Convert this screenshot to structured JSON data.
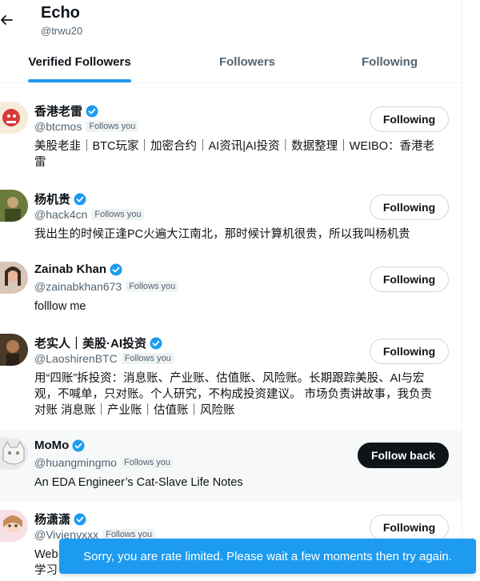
{
  "header": {
    "title": "Echo",
    "handle": "@trwu20",
    "back_icon": "arrow-left-icon"
  },
  "tabs": [
    {
      "label": "Verified Followers",
      "active": true
    },
    {
      "label": "Followers",
      "active": false
    },
    {
      "label": "Following",
      "active": false
    }
  ],
  "users": [
    {
      "name": "香港老雷",
      "handle": "@btcmos",
      "follows_you": "Follows you",
      "verified": true,
      "bio_lines": [
        "美股老韭｜BTC玩家｜加密合约｜AI资讯|AI投资｜数据整理｜WEIBO：香港老",
        "雷"
      ],
      "button": "Following"
    },
    {
      "name": "杨机贵",
      "handle": "@hack4cn",
      "follows_you": "Follows you",
      "verified": true,
      "bio_lines": [
        "我出生的时候正逢PC火遍大江南北，那时候计算机很贵，所以我叫杨机贵"
      ],
      "button": "Following"
    },
    {
      "name": "Zainab Khan",
      "handle": "@zainabkhan673",
      "follows_you": "Follows you",
      "verified": true,
      "bio_lines": [
        "folllow me"
      ],
      "button": "Following"
    },
    {
      "name": "老实人｜美股·AI投资",
      "handle": "@LaoshirenBTC",
      "follows_you": "Follows you",
      "verified": true,
      "bio_lines": [
        "用“四账”拆投资：消息账、产业账、估值账、风险账。长期跟踪美股、AI与宏",
        "观，不喊单，只对账。个人研究，不构成投资建议。 市场负责讲故事，我负责",
        "对账 消息账｜产业账｜估值账｜风险账"
      ],
      "button": "Following"
    },
    {
      "name": "MoMo",
      "handle": "@huangmingmo",
      "follows_you": "Follows you",
      "verified": true,
      "bio_lines": [
        "An EDA Engineer’s Cat-Slave Life Notes"
      ],
      "button": "Follow back"
    },
    {
      "name": "杨潇潇",
      "handle": "@Vivienvxxx",
      "follows_you": "Follows you",
      "verified": true,
      "bio_lines": [
        "Web",
        "学习"
      ],
      "button": "Following"
    }
  ],
  "toast": {
    "message": "Sorry, you are rate limited. Please wait a few moments then try again."
  },
  "colors": {
    "accent": "#1d9bf0",
    "text": "#0f1419",
    "muted": "#536471",
    "highlight_row": "#f7f9f9"
  }
}
